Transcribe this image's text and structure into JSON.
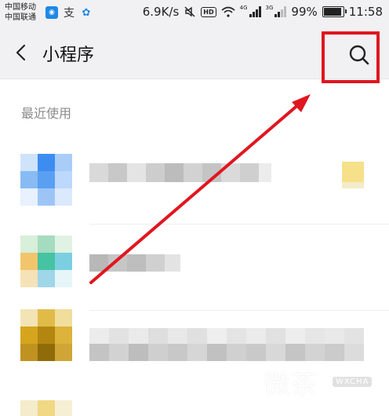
{
  "status_bar": {
    "carrier_1": "中国移动",
    "carrier_2": "中国联通",
    "speed": "6.9K/s",
    "hd_badge": "HD",
    "network_4g": "4G",
    "network_3g": "3G",
    "battery": "99%",
    "time": "11:58"
  },
  "header": {
    "title": "小程序"
  },
  "section": {
    "recent_label": "最近使用"
  },
  "watermark": {
    "logo_text": "微茶",
    "logo_sub": "WXCHA"
  },
  "colors": {
    "highlight_red": "#e0161f",
    "header_bg": "#f1f1f3"
  },
  "icons": [
    "back-arrow-icon",
    "search-icon",
    "mute-icon",
    "wifi-icon",
    "signal-icon",
    "battery-icon"
  ]
}
